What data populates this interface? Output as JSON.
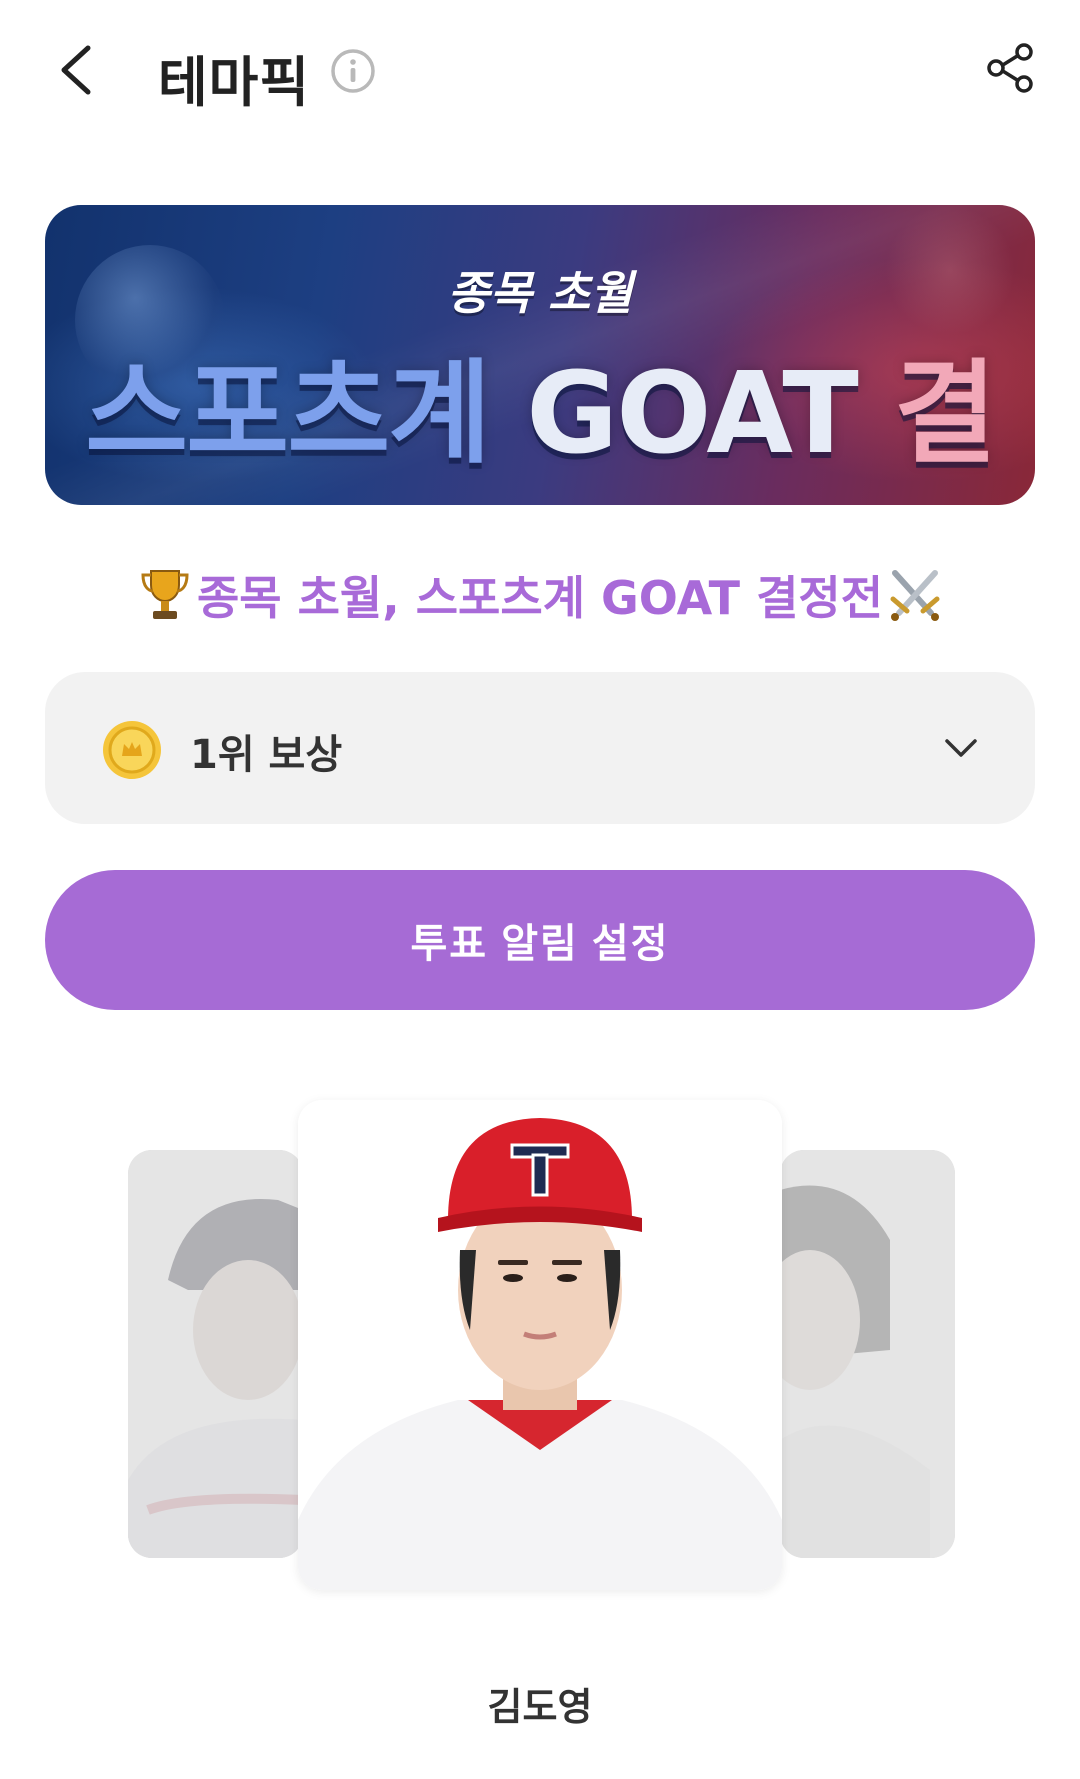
{
  "header": {
    "title": "테마픽",
    "back_icon": "chevron-left-icon",
    "info_icon": "info-icon",
    "share_icon": "share-icon"
  },
  "banner": {
    "subtitle": "종목 초월",
    "title_part1": "스포츠계",
    "title_part2": "GOAT",
    "title_part3": "결정전!"
  },
  "headline": {
    "text": "종목 초월, 스포츠계 GOAT 결정전",
    "leading_icon": "trophy-icon",
    "trailing_icon": "crossed-swords-icon",
    "color": "#a86ad8"
  },
  "reward": {
    "label": "1위 보상",
    "icon": "coin-icon",
    "dropdown_icon": "chevron-down-icon"
  },
  "alert_button": {
    "label": "투표 알림 설정",
    "color": "#a66bd5"
  },
  "carousel": {
    "current_name": "김도영"
  }
}
